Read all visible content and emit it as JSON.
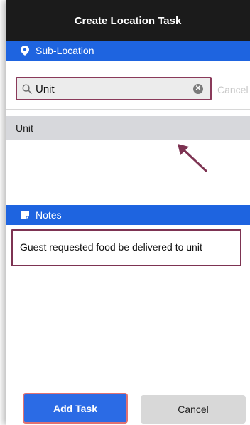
{
  "header": {
    "title": "Create Location Task"
  },
  "sub_location": {
    "label": "Sub-Location",
    "search": {
      "value": "Unit"
    },
    "cancel_label": "Cancel",
    "results": [
      "Unit"
    ]
  },
  "notes": {
    "label": "Notes",
    "text": "Guest requested food be delivered to unit"
  },
  "actions": {
    "add_label": "Add Task",
    "cancel_label": "Cancel"
  },
  "colors": {
    "header_bg": "#1b1b1b",
    "accent_blue": "#1e64e0",
    "button_blue": "#2b6be5",
    "highlight_border": "#8a3a5a",
    "annotation_arrow": "#7d3352"
  },
  "icons": {
    "sub_location": "location-pin-icon",
    "notes": "note-icon",
    "search": "search-icon",
    "clear": "clear-icon"
  }
}
